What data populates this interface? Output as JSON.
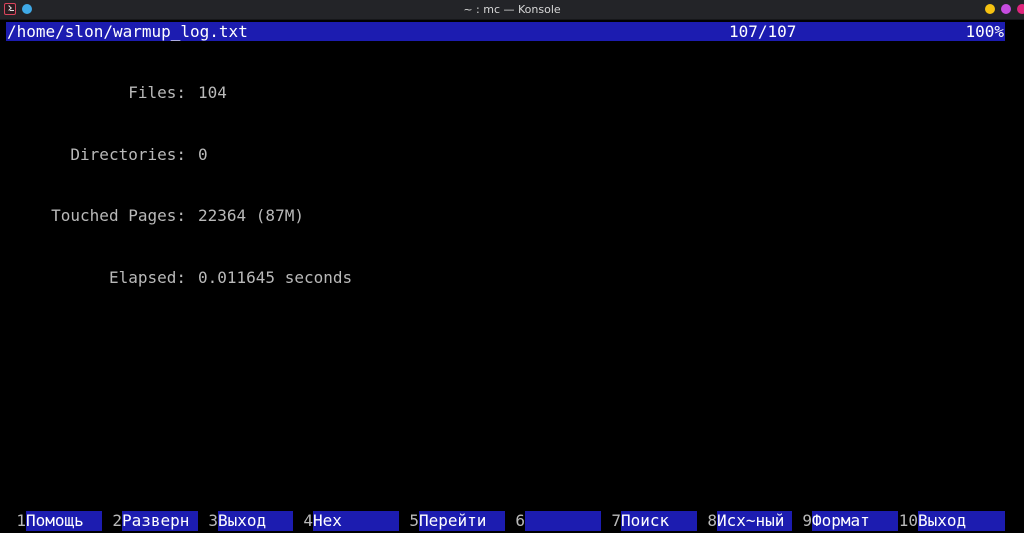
{
  "window": {
    "title": "~ : mc — Konsole"
  },
  "viewer": {
    "path": "/home/slon/warmup_log.txt",
    "line_position": "107/107",
    "percent": "100%"
  },
  "content": {
    "rows": [
      {
        "key": "Files:",
        "value": "104"
      },
      {
        "key": "Directories:",
        "value": "0"
      },
      {
        "key": "Touched Pages:",
        "value": "22364 (87M)"
      },
      {
        "key": "Elapsed:",
        "value": "0.011645 seconds"
      }
    ]
  },
  "fkeys": [
    {
      "num": "1",
      "label": "Помощь"
    },
    {
      "num": "2",
      "label": "Разверн"
    },
    {
      "num": "3",
      "label": "Выход"
    },
    {
      "num": "4",
      "label": "Hex"
    },
    {
      "num": "5",
      "label": "Перейти"
    },
    {
      "num": "6",
      "label": ""
    },
    {
      "num": "7",
      "label": "Поиск"
    },
    {
      "num": "8",
      "label": "Исх~ный"
    },
    {
      "num": "9",
      "label": "Формат"
    },
    {
      "num": "10",
      "label": "Выход"
    }
  ],
  "colors": {
    "bar_blue": "#1c1cb0",
    "text_gray": "#b9b9b9",
    "background": "#000000"
  },
  "icons": {
    "app": "konsole-terminal-icon",
    "pin": "pin-dot-icon",
    "minimize": "minimize-icon",
    "maximize": "maximize-icon",
    "close": "close-icon"
  }
}
